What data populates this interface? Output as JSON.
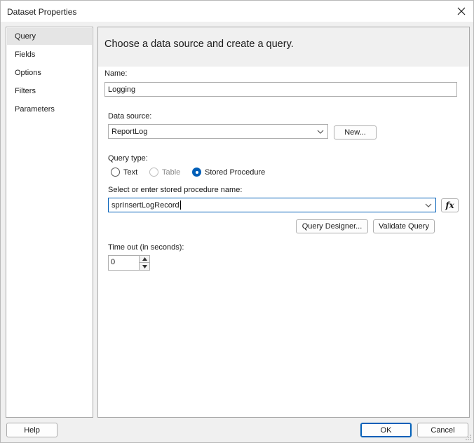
{
  "window": {
    "title": "Dataset Properties"
  },
  "nav": {
    "items": [
      {
        "label": "Query",
        "selected": true
      },
      {
        "label": "Fields",
        "selected": false
      },
      {
        "label": "Options",
        "selected": false
      },
      {
        "label": "Filters",
        "selected": false
      },
      {
        "label": "Parameters",
        "selected": false
      }
    ]
  },
  "content": {
    "header": "Choose a data source and create a query.",
    "name": {
      "label": "Name:",
      "value": "Logging"
    },
    "data_source": {
      "label": "Data source:",
      "value": "ReportLog",
      "new_button": "New..."
    },
    "query_type": {
      "label": "Query type:",
      "options": [
        {
          "label": "Text",
          "checked": false,
          "disabled": false
        },
        {
          "label": "Table",
          "checked": false,
          "disabled": true
        },
        {
          "label": "Stored Procedure",
          "checked": true,
          "disabled": false
        }
      ]
    },
    "stored_procedure": {
      "label": "Select or enter stored procedure name:",
      "value": "sprInsertLogRecord",
      "fx_button": "fx"
    },
    "query_designer_button": "Query Designer...",
    "validate_query_button": "Validate Query",
    "timeout": {
      "label": "Time out (in seconds):",
      "value": "0"
    }
  },
  "footer": {
    "help": "Help",
    "ok": "OK",
    "cancel": "Cancel"
  },
  "icons": {
    "close": "close-icon",
    "dropdown": "chevron-down-icon",
    "spin_up": "triangle-up-icon",
    "spin_down": "triangle-down-icon",
    "grip": "resize-grip-icon"
  },
  "colors": {
    "accent": "#005fb8",
    "selected_nav": "#e5e5e5",
    "header_band": "#f0f0f0"
  }
}
